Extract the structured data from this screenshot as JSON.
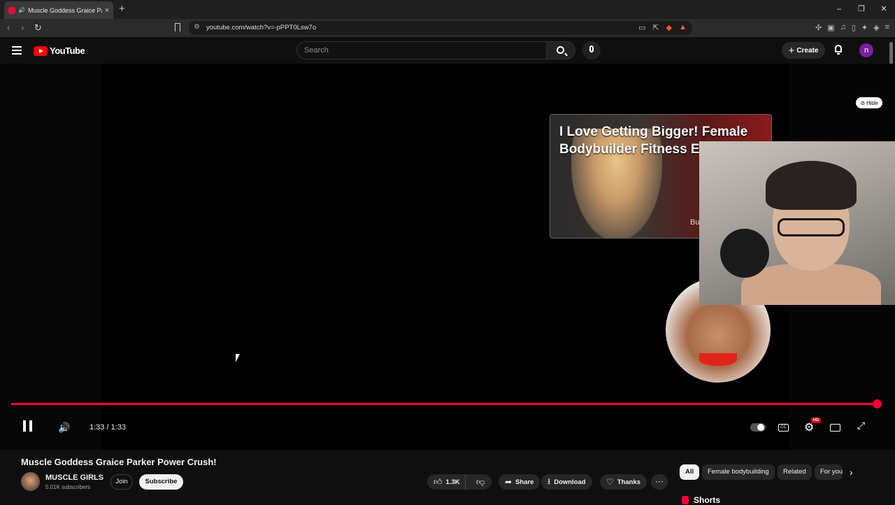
{
  "browser": {
    "tab_title": "Muscle Goddess Graice Parker",
    "url": "youtube.com/watch?v=-pPPT0Lsw7o",
    "new_tab": "+",
    "window_controls": [
      "–",
      "❐",
      "✕"
    ]
  },
  "youtube": {
    "logo_text": "YouTube",
    "search_placeholder": "Search",
    "create_label": "Create",
    "avatar_initial": "n"
  },
  "player": {
    "hide_label": "Hide",
    "endcard_title": "I Love Getting Bigger! Female Bodybuilder Fitness E",
    "endcard_corner_text": "Bu",
    "time": "1:33 / 1:33",
    "progress_fraction": 1.0,
    "hd_badge": "HD"
  },
  "video": {
    "title": "Muscle Goddess Graice Parker Power Crush!",
    "channel_name": "MUSCLE GIRLS",
    "subscribers": "5.01K subscribers",
    "join_label": "Join",
    "subscribe_label": "Subscribe",
    "like_count": "1.3K",
    "share_label": "Share",
    "download_label": "Download",
    "thanks_label": "Thanks",
    "more_label": "···"
  },
  "chips": [
    "All",
    "Female bodybuilding",
    "Related",
    "For you"
  ],
  "shorts_label": "Shorts",
  "colors": {
    "accent": "#ff0033",
    "background": "#0f0f0f"
  }
}
